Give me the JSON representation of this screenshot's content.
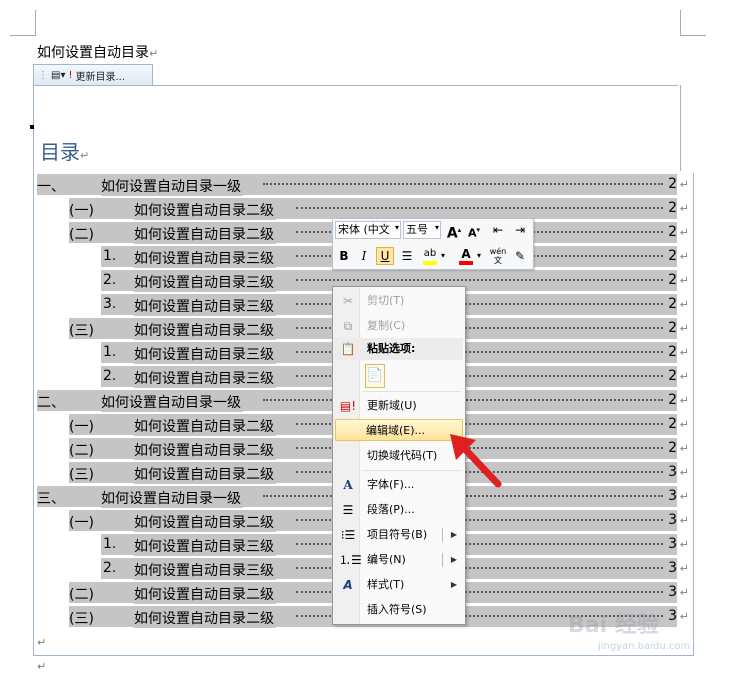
{
  "document": {
    "title": "如何设置自动目录",
    "pilcrow": "↵"
  },
  "toc_control": {
    "update_label": "更新目录...",
    "heading": "目录"
  },
  "toc_entries": [
    {
      "num": "一、",
      "text": "如何设置自动目录一级",
      "page": "2",
      "level": 1
    },
    {
      "num": "(一)",
      "text": "如何设置自动目录二级",
      "page": "2",
      "level": 2
    },
    {
      "num": "(二)",
      "text": "如何设置自动目录二级",
      "page": "2",
      "level": 2
    },
    {
      "num": "1.",
      "text": "如何设置自动目录三级",
      "page": "2",
      "level": 3
    },
    {
      "num": "2.",
      "text": "如何设置自动目录三级",
      "page": "2",
      "level": 3
    },
    {
      "num": "3.",
      "text": "如何设置自动目录三级",
      "page": "2",
      "level": 3
    },
    {
      "num": "(三)",
      "text": "如何设置自动目录二级",
      "page": "2",
      "level": 2
    },
    {
      "num": "1.",
      "text": "如何设置自动目录三级",
      "page": "2",
      "level": 3
    },
    {
      "num": "2.",
      "text": "如何设置自动目录三级",
      "page": "2",
      "level": 3
    },
    {
      "num": "二、",
      "text": "如何设置自动目录一级",
      "page": "2",
      "level": 1
    },
    {
      "num": "(一)",
      "text": "如何设置自动目录二级",
      "page": "2",
      "level": 2
    },
    {
      "num": "(二)",
      "text": "如何设置自动目录二级",
      "page": "2",
      "level": 2
    },
    {
      "num": "(三)",
      "text": "如何设置自动目录二级",
      "page": "3",
      "level": 2
    },
    {
      "num": "三、",
      "text": "如何设置自动目录一级",
      "page": "3",
      "level": 1
    },
    {
      "num": "(一)",
      "text": "如何设置自动目录二级",
      "page": "3",
      "level": 2
    },
    {
      "num": "1.",
      "text": "如何设置自动目录三级",
      "page": "3",
      "level": 3
    },
    {
      "num": "2.",
      "text": "如何设置自动目录三级",
      "page": "3",
      "level": 3
    },
    {
      "num": "(二)",
      "text": "如何设置自动目录二级",
      "page": "3",
      "level": 2
    },
    {
      "num": "(三)",
      "text": "如何设置自动目录二级",
      "page": "3",
      "level": 2
    }
  ],
  "mini_toolbar": {
    "font_name": "宋体 (中文",
    "font_size": "五号",
    "grow_font": "A",
    "shrink_font": "A",
    "bold": "B",
    "italic": "I",
    "underline": "U",
    "font_color_label": "A",
    "phonetic_label": "wén",
    "highlight_color": "#ffff00",
    "font_color": "#ff0000"
  },
  "context_menu": {
    "cut": "剪切(T)",
    "copy": "复制(C)",
    "paste_options": "粘贴选项:",
    "update_field": "更新域(U)",
    "edit_field": "编辑域(E)...",
    "toggle_field_codes": "切换域代码(T)",
    "font": "字体(F)...",
    "paragraph": "段落(P)...",
    "bullets": "项目符号(B)",
    "numbering": "编号(N)",
    "styles": "样式(T)",
    "insert_symbol": "插入符号(S)"
  },
  "watermark": {
    "text": "Bai 经验",
    "sub": "jingyan.baidu.com"
  },
  "colors": {
    "toc_highlight": "#c5c5c5",
    "heading_blue": "#365f91",
    "menu_hover": "#ffe39a",
    "arrow_red": "#e02020"
  }
}
